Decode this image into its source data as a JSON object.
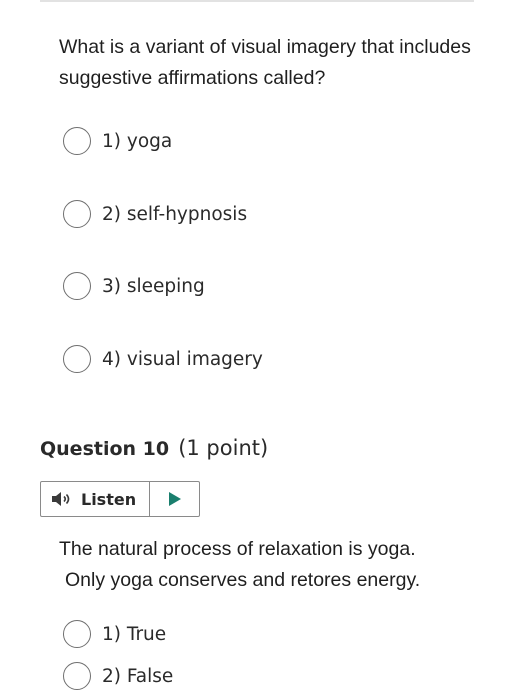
{
  "question9": {
    "prompt": "What is a variant of visual imagery that includes suggestive affirmations called?",
    "options": [
      {
        "label": "1) yoga"
      },
      {
        "label": "2) self-hypnosis"
      },
      {
        "label": "3) sleeping"
      },
      {
        "label": "4) visual imagery"
      }
    ]
  },
  "question10": {
    "title": "Question 10",
    "points": "(1 point)",
    "listen_label": "Listen",
    "prompt_line1": "The natural process of relaxation is yoga.",
    "prompt_line2": "Only yoga conserves and retores energy.",
    "options": [
      {
        "label": "1) True"
      },
      {
        "label": "2) False"
      }
    ]
  },
  "icons": {
    "speaker": "speaker-icon",
    "play": "play-icon"
  },
  "colors": {
    "play_accent": "#1a7f6e"
  }
}
